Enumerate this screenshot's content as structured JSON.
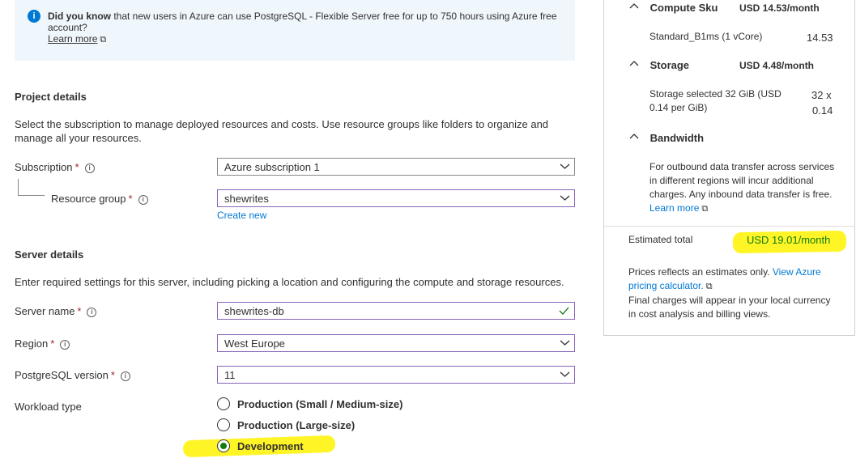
{
  "banner": {
    "bold": "Did you know",
    "text": " that new users in Azure can use PostgreSQL - Flexible Server free for up to 750 hours using Azure free account?",
    "link": "Learn more"
  },
  "project": {
    "title": "Project details",
    "desc": "Select the subscription to manage deployed resources and costs. Use resource groups like folders to organize and manage all your resources.",
    "subscription_label": "Subscription",
    "subscription_value": "Azure subscription 1",
    "rg_label": "Resource group",
    "rg_value": "shewrites",
    "create_new": "Create new"
  },
  "server": {
    "title": "Server details",
    "desc": "Enter required settings for this server, including picking a location and configuring the compute and storage resources.",
    "name_label": "Server name",
    "name_value": "shewrites-db",
    "region_label": "Region",
    "region_value": "West Europe",
    "version_label": "PostgreSQL version",
    "version_value": "11",
    "workload_label": "Workload type",
    "workload_options": [
      "Production (Small / Medium-size)",
      "Production (Large-size)",
      "Development"
    ],
    "workload_selected": "Development"
  },
  "required_mark": "*",
  "cost": {
    "compute_title": "Compute Sku",
    "compute_amount": "USD 14.53/month",
    "compute_item": "Standard_B1ms (1 vCore)",
    "compute_item_value": "14.53",
    "storage_title": "Storage",
    "storage_amount": "USD 4.48/month",
    "storage_item": "Storage selected 32 GiB (USD 0.14 per GiB)",
    "storage_item_value_1": "32 x",
    "storage_item_value_2": "0.14",
    "bandwidth_title": "Bandwidth",
    "bandwidth_text": "For outbound data transfer across services in different regions will incur additional charges. Any inbound data transfer is free.",
    "bandwidth_link": "Learn more",
    "total_label": "Estimated total",
    "total_value": "USD 19.01/month",
    "note_1": "Prices reflects an estimates only.",
    "note_link": "View Azure pricing calculator.",
    "note_2": "Final charges will appear in your local currency in cost analysis and billing views."
  },
  "colors": {
    "accent": "#0078d4",
    "highlight": "#fff200",
    "selected_radio": "#107c10",
    "total_text": "#107c10"
  }
}
